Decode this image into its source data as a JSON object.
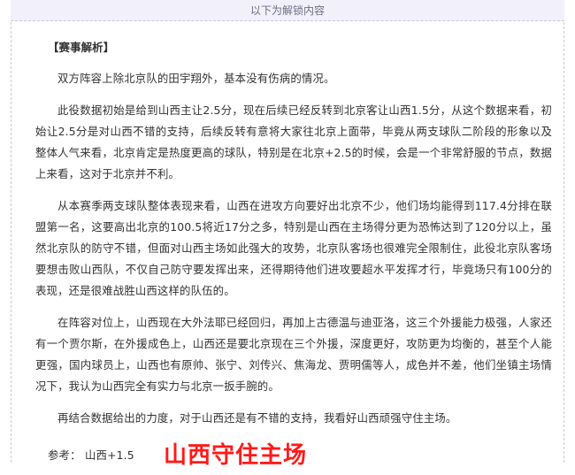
{
  "banner": {
    "text": "以下为解锁内容"
  },
  "article": {
    "section_title": "【赛事解析】",
    "paragraphs": [
      "双方阵容上除北京队的田宇翔外，基本没有伤病的情况。",
      "此役数据初始是给到山西主让2.5分，现在后续已经反转到北京客让山西1.5分，从这个数据来看，初始让2.5分是对山西不错的支持，后续反转有意将大家往北京上面带，毕竟从两支球队二阶段的形象以及整体人气来看，北京肯定是热度更高的球队，特别是在北京+2.5的时候，会是一个非常舒服的节点，数据上来看，这对于北京并不利。",
      "从本赛季两支球队整体表现来看，山西在进攻方向要好出北京不少，他们场均能得到117.4分排在联盟第一名，这要高出北京的100.5将近17分之多，特别是山西在主场得分更为恐怖达到了120分以上，虽然北京队的防守不错，但面对山西主场如此强大的攻势，北京队客场也很难完全限制住，此役北京队客场要想击败山西队，不仅自己防守要发挥出来，还得期待他们进攻要超水平发挥才行，毕竟场只有100分的表现，还是很难战胜山西这样的队伍的。",
      "在阵容对位上，山西现在大外法耶已经回归，再加上古德温与迪亚洛，这三个外援能力极强，人家还有一个贾尔斯，在外援成色上，山西还是要北京现在三个外援，深度更好，攻防更为均衡的，甚至个人能更强，国内球员上，山西也有原帅、张宁、刘传兴、焦海龙、贾明儒等人，成色并不差，他们坐镇主场情况下，我认为山西完全有实力与北京一扳手腕的。",
      "再结合数据给出的力度，对于山西还是有不错的支持，我看好山西顽强守住主场。"
    ],
    "reference_label": "参考：",
    "reference_value": "山西+1.5",
    "highlight": "山西守住主场"
  }
}
